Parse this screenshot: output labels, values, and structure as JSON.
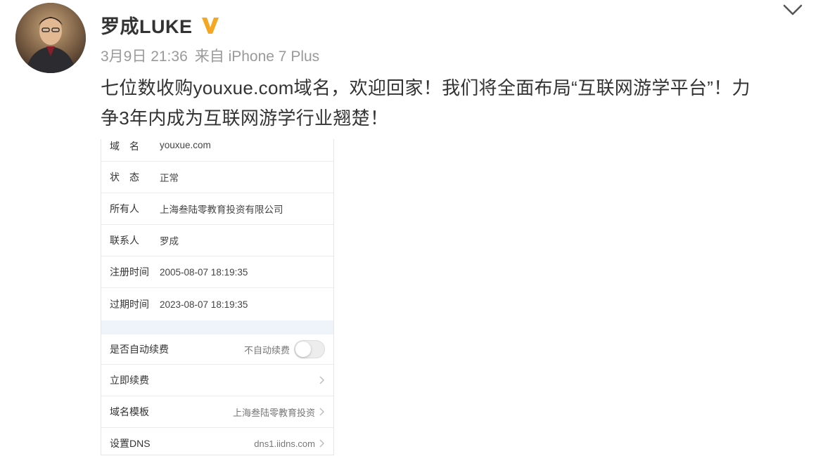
{
  "author": {
    "name": "罗成LUKE",
    "verified_color": "#f5a623"
  },
  "meta": {
    "date": "3月9日 21:36",
    "source": "来自 iPhone 7 Plus"
  },
  "post": {
    "text_line1": "七位数收购youxue.com域名，欢迎回家！我们将全面布局“互联网游学平台”！力",
    "text_line2": "争3年内成为互联网游学行业翘楚！"
  },
  "domain_info": {
    "rows": [
      {
        "label": "域　名",
        "value": "youxue.com"
      },
      {
        "label": "状　态",
        "value": "正常"
      },
      {
        "label": "所有人",
        "value": "上海叁陆零教育投资有限公司"
      },
      {
        "label": "联系人",
        "value": "罗成"
      },
      {
        "label": "注册时间",
        "value": "2005-08-07 18:19:35"
      },
      {
        "label": "过期时间",
        "value": "2023-08-07 18:19:35"
      }
    ],
    "auto_renew": {
      "label": "是否自动续费",
      "status": "不自动续费"
    },
    "renew_now": {
      "label": "立即续费"
    },
    "template": {
      "label": "域名模板",
      "value": "上海叁陆零教育投资"
    },
    "dns": {
      "label": "设置DNS",
      "value": "dns1.iidns.com"
    }
  }
}
